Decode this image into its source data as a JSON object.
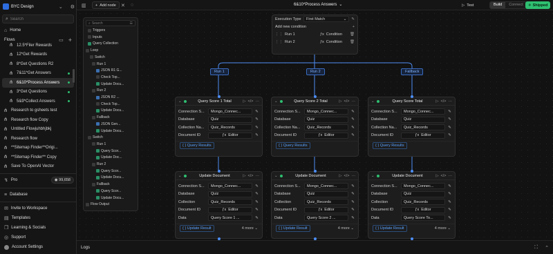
{
  "workspace": {
    "name": "BYC Design"
  },
  "sidebar": {
    "search_placeholder": "Search",
    "home": "Home",
    "flows_label": "Flows",
    "flows": [
      {
        "label": "12.5*Filer Rewards",
        "level": 1,
        "active": false,
        "dot": false
      },
      {
        "label": "12*Get Rewards",
        "level": 1,
        "active": false,
        "dot": false
      },
      {
        "label": "8*Get Questions R2",
        "level": 1,
        "active": false,
        "dot": false
      },
      {
        "label": "7&11*Get Answers",
        "level": 1,
        "active": false,
        "dot": true
      },
      {
        "label": "6&10*Process Answers",
        "level": 1,
        "active": true,
        "dot": true
      },
      {
        "label": "3*Get Questions",
        "level": 1,
        "active": false,
        "dot": true
      },
      {
        "label": "5&9*Collect Answers",
        "level": 1,
        "active": false,
        "dot": true
      },
      {
        "label": "Research to gsheets test",
        "level": 0,
        "active": false,
        "dot": false
      },
      {
        "label": "Research flow Copy",
        "level": 0,
        "active": false,
        "dot": false
      },
      {
        "label": "Untitled Flowjuhbhjbkj",
        "level": 0,
        "active": false,
        "dot": false
      },
      {
        "label": "Research flow",
        "level": 0,
        "active": false,
        "dot": false
      },
      {
        "label": "**Sitemap Finder**Origi...",
        "level": 0,
        "active": false,
        "dot": false
      },
      {
        "label": "**Sitemap Finder** Copy",
        "level": 0,
        "active": false,
        "dot": false
      },
      {
        "label": "Save To OpenAI Vector",
        "level": 0,
        "active": false,
        "dot": false
      }
    ],
    "plan": "Pro",
    "credits": "99,658",
    "database": "Database",
    "bottom": [
      "Invite to Workspace",
      "Templates",
      "Learning & Socials",
      "Support",
      "Account Settings"
    ]
  },
  "topbar": {
    "add_node": "Add node",
    "title": "6&10*Process Answers",
    "test": "Test",
    "build": "Build",
    "connect": "Connect",
    "shipped": "Shipped"
  },
  "tree": {
    "search_placeholder": "Search",
    "rows": [
      "Triggers",
      "Inputs",
      "Query Collection",
      "Loop",
      "Switch",
      "Run 1",
      "JSON R1 G...",
      "Check Top...",
      "Update Docu...",
      "Run 2",
      "JSON R2 ...",
      "Check Top...",
      "Update Docu...",
      "Fallback",
      "JSON Gen...",
      "Update Docu...",
      "Switch",
      "Run 1",
      "Query Scor...",
      "Update Doc...",
      "Run 2",
      "Query Scor...",
      "Update Docu...",
      "Fallback",
      "Query Scor...",
      "Update Docu...",
      "Flow Output"
    ]
  },
  "router": {
    "execution_label": "Execution Type",
    "execution_value": "First Match",
    "add_condition": "Add new condition",
    "runs": [
      {
        "label": "Run 1",
        "condition": "Condition"
      },
      {
        "label": "Run 2",
        "condition": "Condition"
      }
    ]
  },
  "branches": [
    "Run 1",
    "Run 2",
    "Fallback"
  ],
  "query_nodes": [
    {
      "title": "Query Score 1 Total",
      "connection": "Mongo_Connec...",
      "database": "Quiz",
      "collection": "Quiz_Records",
      "document_id": "Editor",
      "output": "Query Results"
    },
    {
      "title": "Query Score 2 Total",
      "connection": "Mongo_Connec...",
      "database": "Quiz",
      "collection": "Quiz_Records",
      "document_id": "Editor",
      "output": "Query Results"
    },
    {
      "title": "Query Score Total",
      "connection": "Mongo_Connec...",
      "database": "Quiz",
      "collection": "Quiz_Records",
      "document_id": "Editor",
      "output": "Query Results"
    }
  ],
  "query_labels": {
    "connection": "Connection S...",
    "database": "Database",
    "collection": "Collection Na...",
    "document_id": "Document ID"
  },
  "update_nodes": [
    {
      "title": "Update Document",
      "connection": "Mongo_Connec...",
      "database": "Quiz",
      "collection": "Quiz_Records",
      "document_id": "Editor",
      "data": "Query Score 1 ...",
      "output": "Update Result",
      "more": "4 more"
    },
    {
      "title": "Update Document",
      "connection": "Mongo_Connec...",
      "database": "Quiz",
      "collection": "Quiz_Records",
      "document_id": "Editor",
      "data": "Query Score 2 ...",
      "output": "Update Result",
      "more": "4 more"
    },
    {
      "title": "Update Document",
      "connection": "Mongo_Connec...",
      "database": "Quiz",
      "collection": "Quiz_Records",
      "document_id": "Editor",
      "data": "Query Score To...",
      "output": "Update Result",
      "more": "4 more"
    }
  ],
  "update_labels": {
    "connection": "Connection S...",
    "database": "Database",
    "collection": "Collection",
    "document_id": "Document ID",
    "data": "Data"
  },
  "logs": {
    "label": "Logs"
  },
  "colors": {
    "accent": "#4d8ef5",
    "status": "#2fbf71",
    "background": "#121212"
  }
}
